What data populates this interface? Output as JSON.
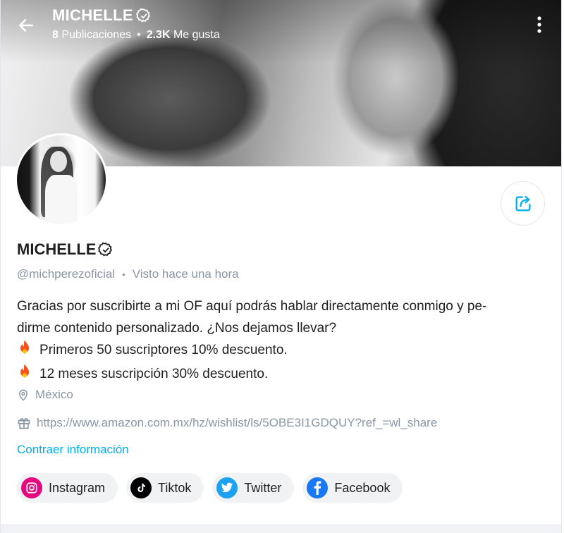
{
  "header": {
    "name": "MICHELLE",
    "stats": {
      "posts_count": "8",
      "posts_label": "Publicaciones",
      "separator": "•",
      "likes_count": "2.3K",
      "likes_label": "Me gusta"
    }
  },
  "profile": {
    "name": "MICHELLE",
    "handle": "@michperezoficial",
    "separator": "•",
    "last_seen": "Visto hace una hora"
  },
  "bio": {
    "line1": "Gracias por suscribirte a mi OF aquí podrás hablar directamente conmigo y pe-",
    "line2": "dirme contenido personalizado. ¿Nos dejamos llevar?",
    "line3_emoji": "🔥",
    "line3": "Primeros 50 suscriptores 10% descuento.",
    "line4_emoji": "🔥",
    "line4": "12 meses suscripción 30% descuento."
  },
  "location": "México",
  "wishlist_url": "https://www.amazon.com.mx/hz/wishlist/ls/5OBE3I1GDQUY?ref_=wl_share",
  "collapse_label": "Contraer información",
  "socials": [
    {
      "label": "Instagram",
      "icon": "instagram-icon",
      "color": "#e4097f"
    },
    {
      "label": "Tiktok",
      "icon": "tiktok-icon",
      "color": "#000000"
    },
    {
      "label": "Twitter",
      "icon": "twitter-icon",
      "color": "#1da1f2"
    },
    {
      "label": "Facebook",
      "icon": "facebook-icon",
      "color": "#1877f2"
    }
  ],
  "colors": {
    "accent": "#00aff0",
    "muted": "#8a96a3",
    "text": "#1f1f1f"
  }
}
